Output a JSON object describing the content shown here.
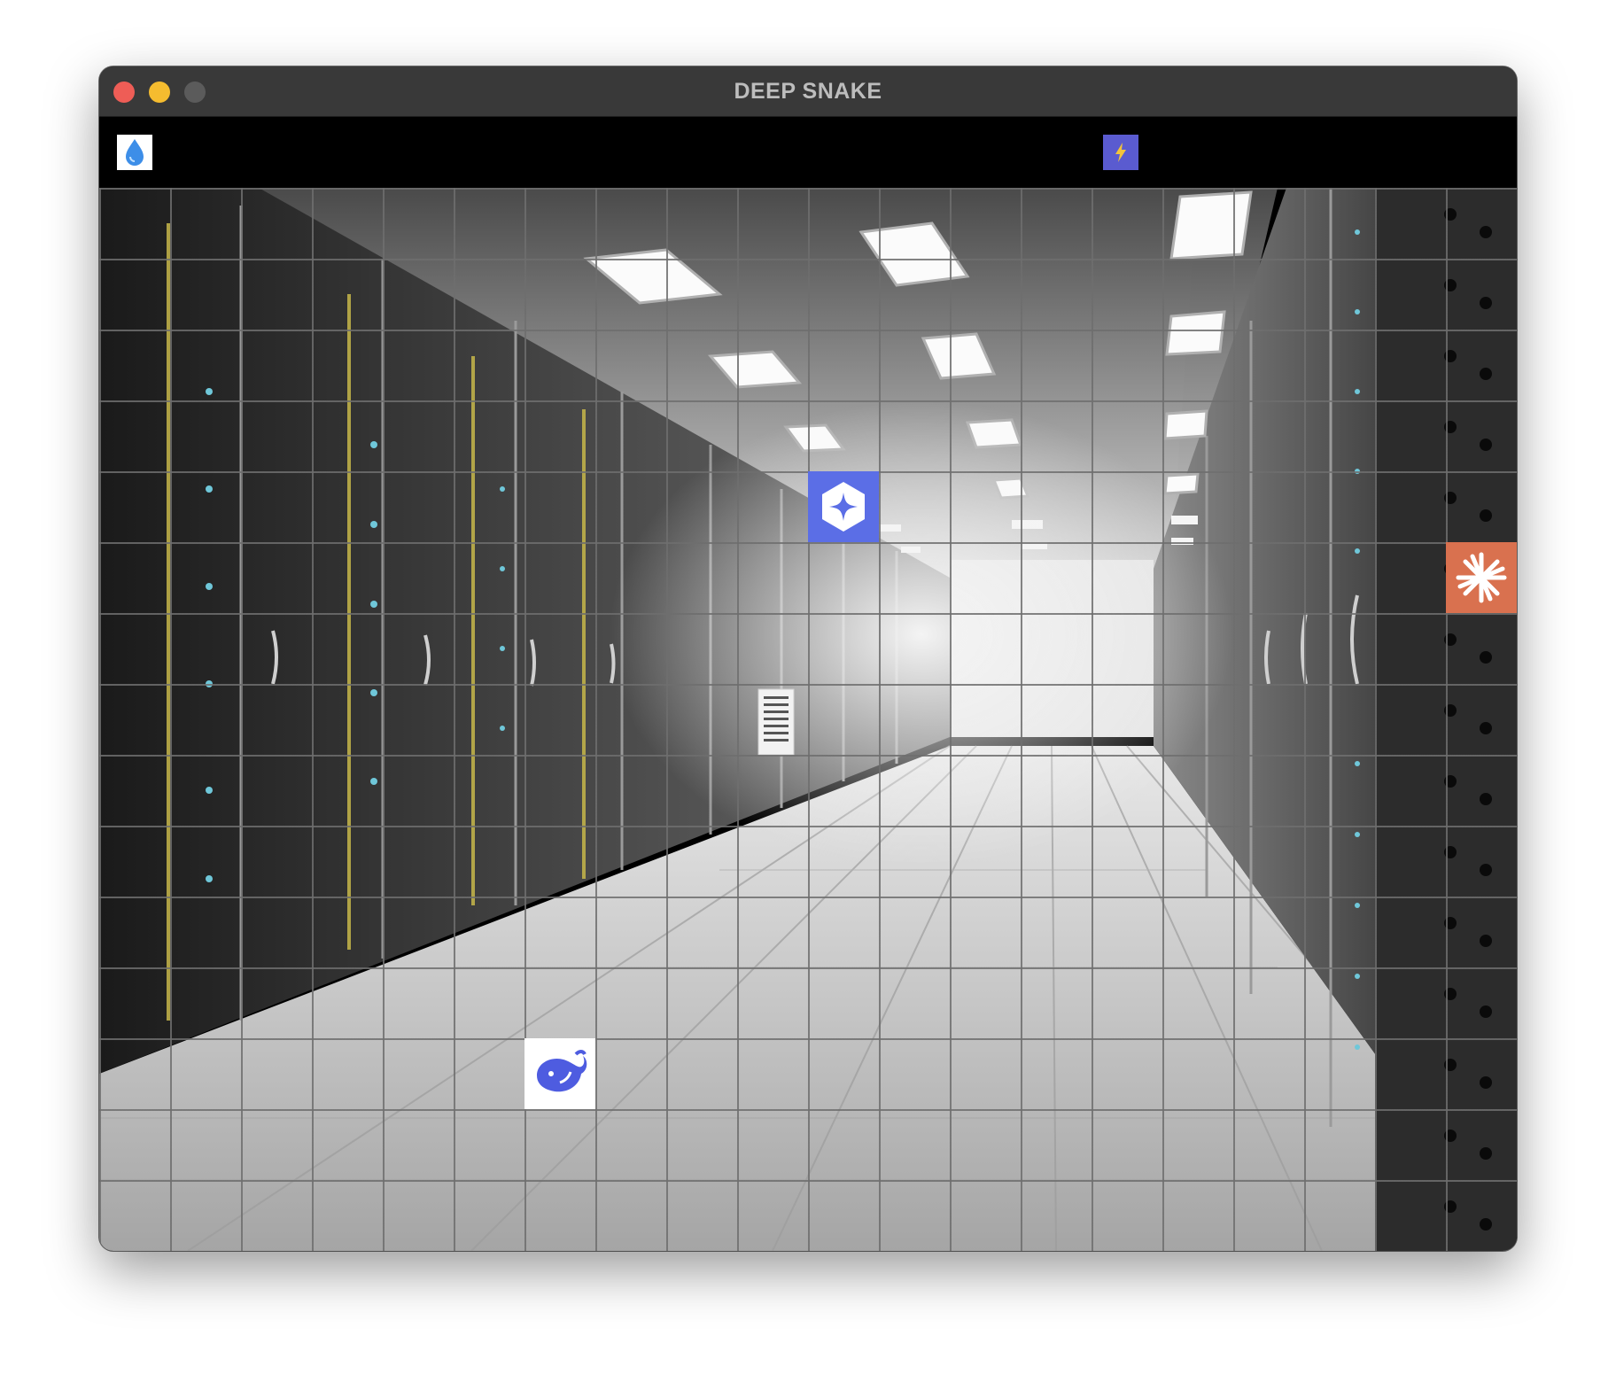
{
  "window": {
    "title": "DEEP SNAKE"
  },
  "hud": {
    "left_icon": "water-drop-icon",
    "center_icon": "lightning-bolt-icon"
  },
  "board": {
    "columns": 20,
    "rows": 15,
    "background": "server-room-corridor-image",
    "grid_color": "#6e6e6e",
    "items": [
      {
        "name": "gemini-sparkle-icon",
        "kind": "collectible",
        "col": 10,
        "row": 4,
        "bg": "#5b6ee6"
      },
      {
        "name": "claude-asterisk-icon",
        "kind": "collectible",
        "col": 19,
        "row": 5,
        "bg": "#d9714f"
      },
      {
        "name": "deepseek-whale-icon",
        "kind": "snake-head",
        "col": 6,
        "row": 12,
        "bg": "#ffffff"
      }
    ]
  },
  "colors": {
    "titlebar": "#393939",
    "hud_background": "#000000",
    "close": "#ee5d56",
    "minimize": "#f5bc2f",
    "maximize": "#5b5b5b",
    "accent_blue": "#4e5ce0",
    "accent_orange": "#d9714f"
  }
}
